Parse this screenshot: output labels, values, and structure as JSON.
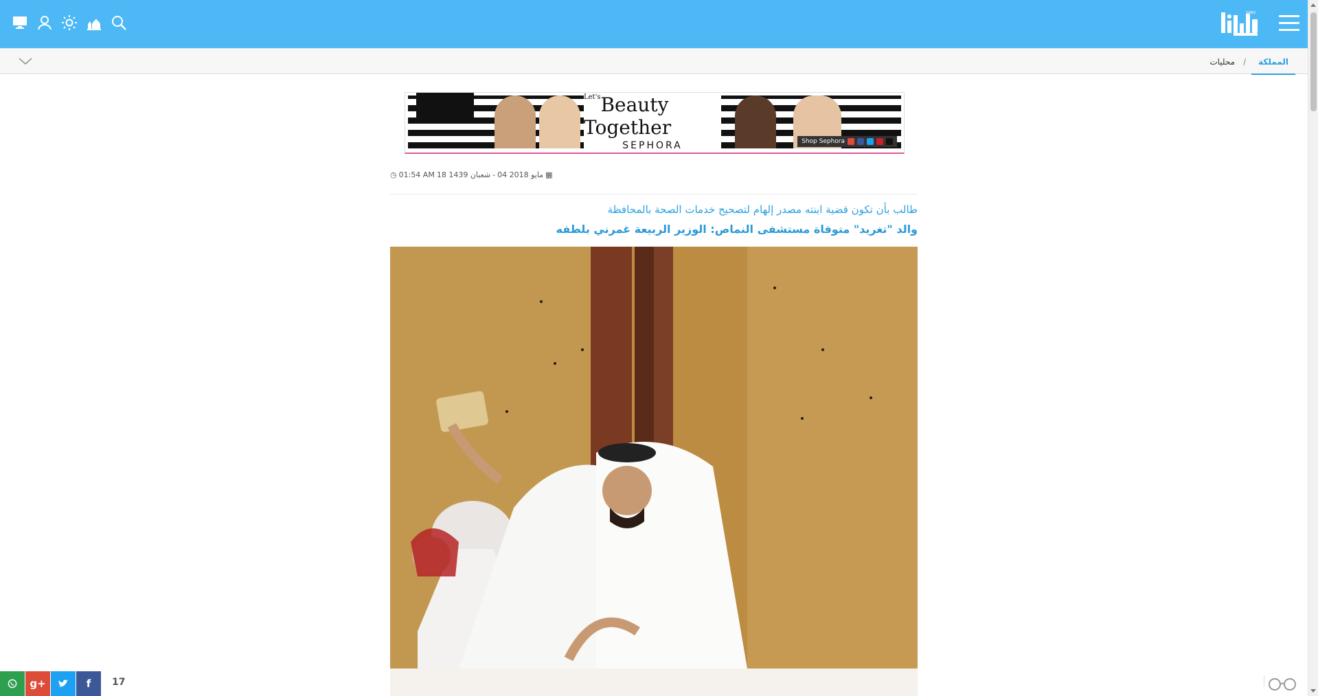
{
  "header": {
    "logo_alt": "sabq",
    "tools": [
      "desktop-icon",
      "user-icon",
      "brightness-icon",
      "prayer-icon",
      "search-icon"
    ],
    "accent": "#4cb8f5"
  },
  "breadcrumb": {
    "active": "المملكة",
    "separator": "/",
    "current": "محليات"
  },
  "ad": {
    "tagline_small": "Let's",
    "tagline": "Beauty Together",
    "brand": "SEPHORA",
    "cta": "Shop Sephora"
  },
  "article": {
    "date_gregorian": "04 مايو 2018",
    "date_hijri": "18 شعبان 1439",
    "time": "01:54 AM",
    "date_separator": " - ",
    "subtitle": "طالب بأن تكون قضية ابنته مصدر إلهام لتصحيح خدمات الصحة بالمحافظة",
    "headline": "والد \"تغريد\" متوفاة مستشفى النماص: الوزير الربيعة غمرني بلطفه"
  },
  "share": {
    "count": "17",
    "buttons": [
      {
        "name": "whatsapp",
        "color": "#2e9e4f"
      },
      {
        "name": "google-plus",
        "color": "#dd4b39"
      },
      {
        "name": "twitter",
        "color": "#1da1f2"
      },
      {
        "name": "facebook",
        "color": "#3b5998"
      }
    ]
  }
}
